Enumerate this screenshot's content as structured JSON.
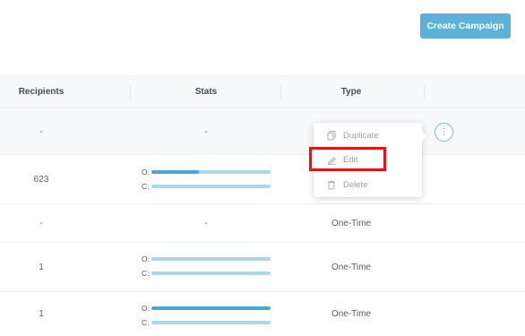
{
  "toolbar": {
    "create_label": "Create Campaign"
  },
  "columns": {
    "recipients": "Recipients",
    "stats": "Stats",
    "type": "Type"
  },
  "rows": [
    {
      "recipients": "-",
      "stats_text": "-",
      "type": "",
      "stats": null
    },
    {
      "recipients": "623",
      "stats_text": "",
      "type": "",
      "stats": {
        "open_label": "O:",
        "open": 0.4,
        "click_label": "C:",
        "click": 0
      }
    },
    {
      "recipients": "-",
      "stats_text": "-",
      "type": "One-Time",
      "stats": null
    },
    {
      "recipients": "1",
      "stats_text": "",
      "type": "One-Time",
      "stats": {
        "open_label": "O:",
        "open": 0,
        "click_label": "C:",
        "click": 0
      }
    },
    {
      "recipients": "1",
      "stats_text": "",
      "type": "One-Time",
      "stats": {
        "open_label": "O:",
        "open": 1.0,
        "click_label": "C:",
        "click": 0
      }
    }
  ],
  "menu": {
    "items": [
      {
        "label": "Duplicate",
        "icon": "copy-icon"
      },
      {
        "label": "Edit",
        "icon": "pencil-icon"
      },
      {
        "label": "Delete",
        "icon": "trash-icon"
      }
    ]
  },
  "kebab": {
    "glyph": "⋮"
  },
  "colors": {
    "accent": "#5eb1d6",
    "bar_fill": "#4aa6d0",
    "bar_track": "#a9d9e9",
    "highlight": "#e0151a"
  }
}
